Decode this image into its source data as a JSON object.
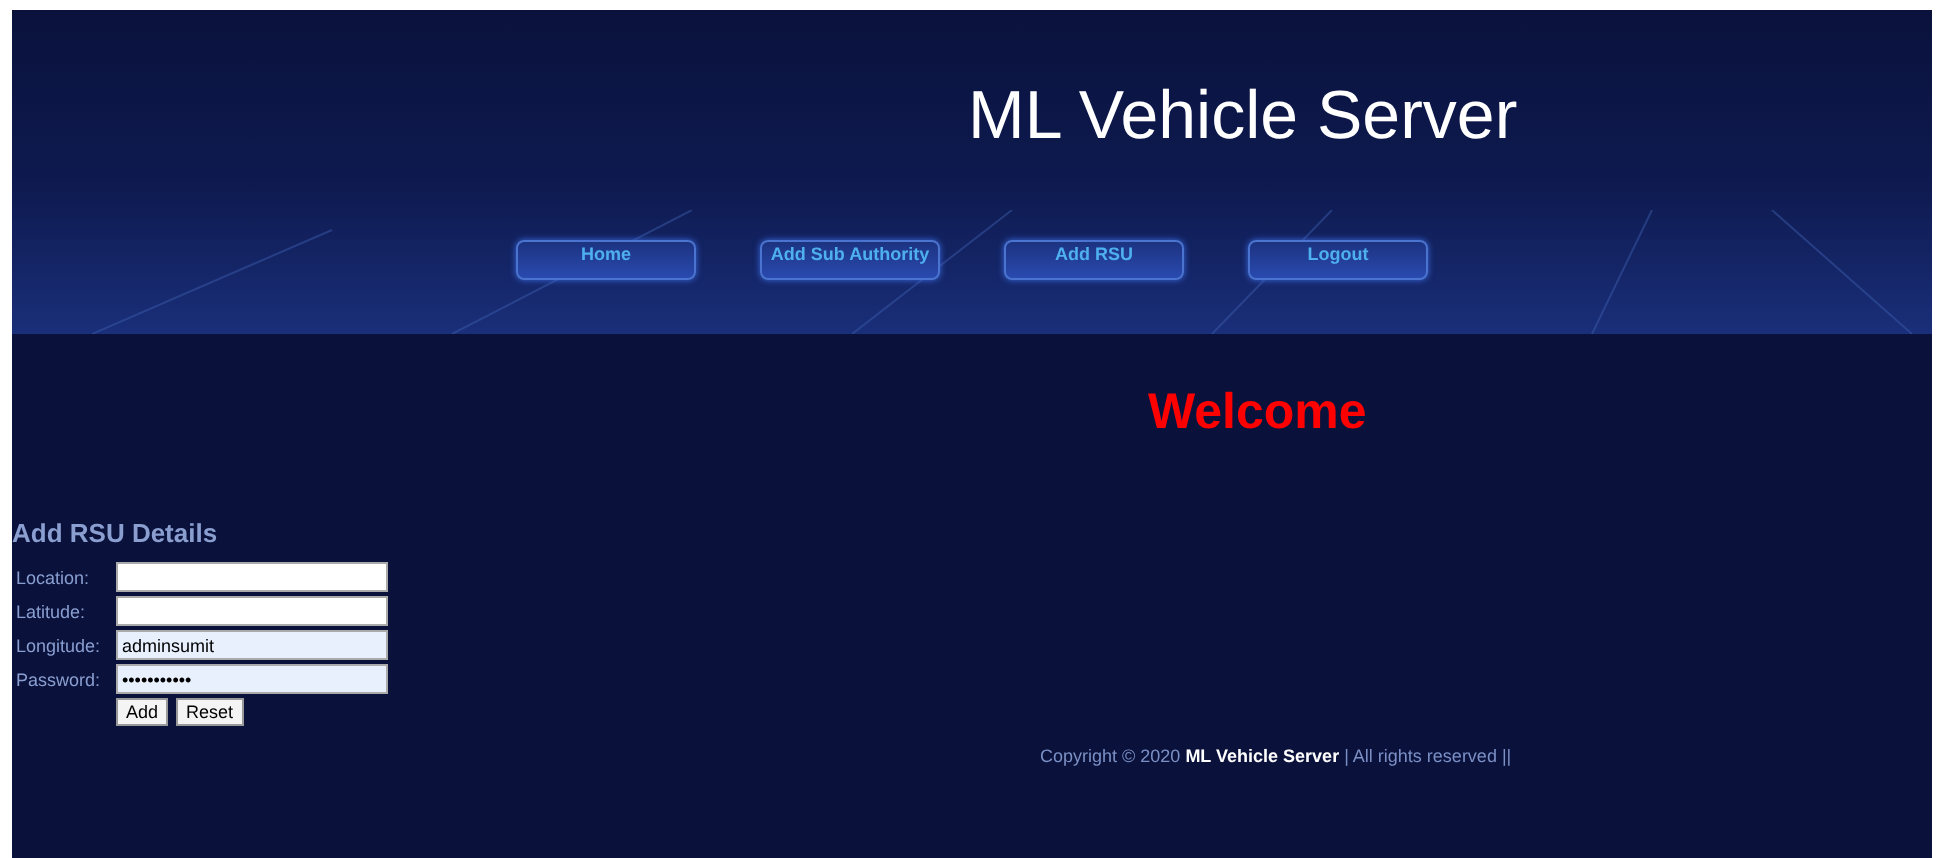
{
  "header": {
    "title": "ML Vehicle Server"
  },
  "nav": [
    {
      "label": "Home"
    },
    {
      "label": "Add Sub Authority"
    },
    {
      "label": "Add RSU"
    },
    {
      "label": "Logout"
    }
  ],
  "welcome": "Welcome",
  "form": {
    "title": "Add RSU Details",
    "fields": [
      {
        "label": "Location:",
        "autofilled": false
      },
      {
        "label": "Latitude:",
        "autofilled": false
      },
      {
        "label": "Longitude:",
        "value": "adminsumit",
        "autofilled": true
      },
      {
        "label": "Password:",
        "value": "•••••••••••",
        "autofilled": true
      }
    ],
    "buttons": [
      "Add",
      "Reset"
    ]
  },
  "footer": {
    "prefix": "Copyright © 2020",
    "brand": "ML Vehicle Server",
    "suffix": "| All rights reserved ||"
  }
}
